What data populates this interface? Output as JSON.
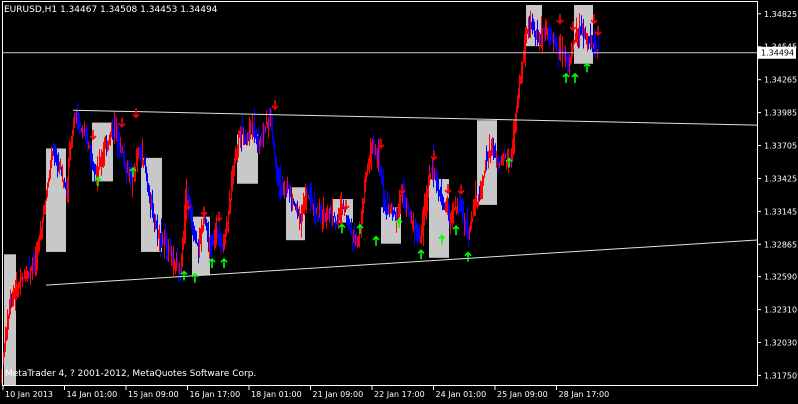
{
  "window": {
    "symbol_info": "EURUSD,H1  1.34467 1.34508 1.34453 1.34494",
    "copyright": "MetaTrader 4, ? 2001-2012, MetaQuotes Software Corp.",
    "current_price_label": "1.34494"
  },
  "colors": {
    "background": "#000000",
    "frame": "#ffffff",
    "bull": "#ff0000",
    "bear": "#0000ff",
    "box": "#c8c8c8",
    "trendline": "#d8e8d8",
    "up_arrow": "#00ff00",
    "down_arrow": "#ff0000"
  },
  "chart_data": {
    "type": "candlestick",
    "symbol": "EURUSD",
    "timeframe": "H1",
    "ylim": [
      1.3166,
      1.349
    ],
    "y_ticks": [
      "1.34825",
      "1.34545",
      "1.34265",
      "1.33985",
      "1.33705",
      "1.33425",
      "1.33145",
      "1.32865",
      "1.32590",
      "1.32310",
      "1.32030",
      "1.31750"
    ],
    "x_ticks": [
      "10 Jan 2013",
      "14 Jan 01:00",
      "15 Jan 09:00",
      "16 Jan 17:00",
      "18 Jan 01:00",
      "21 Jan 09:00",
      "22 Jan 17:00",
      "24 Jan 01:00",
      "25 Jan 09:00",
      "28 Jan 17:00"
    ],
    "current_price": 1.34494,
    "price_path": [
      [
        0,
        1.3173
      ],
      [
        10,
        1.324
      ],
      [
        22,
        1.3256
      ],
      [
        36,
        1.3275
      ],
      [
        46,
        1.333
      ],
      [
        52,
        1.3365
      ],
      [
        60,
        1.335
      ],
      [
        66,
        1.333
      ],
      [
        70,
        1.337
      ],
      [
        74,
        1.3398
      ],
      [
        80,
        1.3385
      ],
      [
        88,
        1.3372
      ],
      [
        96,
        1.3345
      ],
      [
        102,
        1.3362
      ],
      [
        108,
        1.3375
      ],
      [
        114,
        1.3388
      ],
      [
        120,
        1.337
      ],
      [
        126,
        1.335
      ],
      [
        132,
        1.334
      ],
      [
        138,
        1.3365
      ],
      [
        144,
        1.3355
      ],
      [
        150,
        1.332
      ],
      [
        156,
        1.33
      ],
      [
        162,
        1.329
      ],
      [
        168,
        1.3285
      ],
      [
        174,
        1.327
      ],
      [
        180,
        1.3262
      ],
      [
        186,
        1.333
      ],
      [
        192,
        1.33
      ],
      [
        198,
        1.3285
      ],
      [
        204,
        1.331
      ],
      [
        210,
        1.328
      ],
      [
        216,
        1.33
      ],
      [
        222,
        1.3285
      ],
      [
        228,
        1.331
      ],
      [
        234,
        1.336
      ],
      [
        240,
        1.3385
      ],
      [
        246,
        1.3375
      ],
      [
        252,
        1.339
      ],
      [
        258,
        1.337
      ],
      [
        264,
        1.3385
      ],
      [
        270,
        1.3395
      ],
      [
        276,
        1.335
      ],
      [
        282,
        1.333
      ],
      [
        288,
        1.3335
      ],
      [
        294,
        1.332
      ],
      [
        300,
        1.331
      ],
      [
        306,
        1.333
      ],
      [
        312,
        1.332
      ],
      [
        318,
        1.331
      ],
      [
        324,
        1.331
      ],
      [
        330,
        1.3315
      ],
      [
        336,
        1.3305
      ],
      [
        342,
        1.332
      ],
      [
        348,
        1.3305
      ],
      [
        354,
        1.329
      ],
      [
        360,
        1.33
      ],
      [
        366,
        1.335
      ],
      [
        372,
        1.337
      ],
      [
        378,
        1.336
      ],
      [
        384,
        1.332
      ],
      [
        390,
        1.3315
      ],
      [
        396,
        1.331
      ],
      [
        402,
        1.333
      ],
      [
        408,
        1.3315
      ],
      [
        414,
        1.33
      ],
      [
        420,
        1.329
      ],
      [
        426,
        1.333
      ],
      [
        432,
        1.3355
      ],
      [
        438,
        1.333
      ],
      [
        444,
        1.332
      ],
      [
        450,
        1.331
      ],
      [
        456,
        1.332
      ],
      [
        462,
        1.3315
      ],
      [
        468,
        1.3295
      ],
      [
        474,
        1.332
      ],
      [
        480,
        1.333
      ],
      [
        486,
        1.336
      ],
      [
        492,
        1.337
      ],
      [
        498,
        1.3355
      ],
      [
        504,
        1.336
      ],
      [
        510,
        1.3355
      ],
      [
        516,
        1.34
      ],
      [
        520,
        1.343
      ],
      [
        526,
        1.3465
      ],
      [
        532,
        1.3475
      ],
      [
        538,
        1.346
      ],
      [
        544,
        1.347
      ],
      [
        550,
        1.3465
      ],
      [
        556,
        1.3455
      ],
      [
        562,
        1.345
      ],
      [
        568,
        1.344
      ],
      [
        574,
        1.346
      ],
      [
        580,
        1.347
      ],
      [
        586,
        1.3462
      ],
      [
        592,
        1.3458
      ],
      [
        598,
        1.34494
      ]
    ],
    "boxes": [
      {
        "x0": 4,
        "x1": 16,
        "lo": 1.3166,
        "hi": 1.3278
      },
      {
        "x0": 46,
        "x1": 66,
        "lo": 1.328,
        "hi": 1.3368
      },
      {
        "x0": 92,
        "x1": 113,
        "lo": 1.334,
        "hi": 1.339
      },
      {
        "x0": 141,
        "x1": 162,
        "lo": 1.328,
        "hi": 1.336
      },
      {
        "x0": 192,
        "x1": 210,
        "lo": 1.326,
        "hi": 1.331
      },
      {
        "x0": 237,
        "x1": 258,
        "lo": 1.3338,
        "hi": 1.338
      },
      {
        "x0": 286,
        "x1": 305,
        "lo": 1.329,
        "hi": 1.3335
      },
      {
        "x0": 333,
        "x1": 353,
        "lo": 1.3305,
        "hi": 1.3325
      },
      {
        "x0": 381,
        "x1": 401,
        "lo": 1.3287,
        "hi": 1.3318
      },
      {
        "x0": 429,
        "x1": 449,
        "lo": 1.3275,
        "hi": 1.3342
      },
      {
        "x0": 477,
        "x1": 497,
        "lo": 1.332,
        "hi": 1.3392
      },
      {
        "x0": 526,
        "x1": 542,
        "lo": 1.3455,
        "hi": 1.349
      },
      {
        "x0": 574,
        "x1": 593,
        "lo": 1.344,
        "hi": 1.349
      }
    ],
    "trendlines": [
      {
        "x0": 73,
        "y0": 1.34005,
        "x1": 757,
        "y1": 1.33878
      },
      {
        "x0": 46,
        "y0": 1.32518,
        "x1": 757,
        "y1": 1.32902
      }
    ],
    "down_arrows": [
      {
        "x": 93,
        "p": 1.33795
      },
      {
        "x": 122,
        "p": 1.339
      },
      {
        "x": 136,
        "p": 1.3398
      },
      {
        "x": 188,
        "p": 1.332
      },
      {
        "x": 204,
        "p": 1.33145
      },
      {
        "x": 219,
        "p": 1.331
      },
      {
        "x": 275,
        "p": 1.3405
      },
      {
        "x": 346,
        "p": 1.332
      },
      {
        "x": 381,
        "p": 1.3372
      },
      {
        "x": 402,
        "p": 1.33335
      },
      {
        "x": 434,
        "p": 1.3362
      },
      {
        "x": 448,
        "p": 1.33335
      },
      {
        "x": 461,
        "p": 1.3333
      },
      {
        "x": 560,
        "p": 1.3478
      },
      {
        "x": 573,
        "p": 1.3472
      },
      {
        "x": 594,
        "p": 1.3478
      },
      {
        "x": 598,
        "p": 1.3468
      }
    ],
    "up_arrows": [
      {
        "x": 98,
        "p": 1.334
      },
      {
        "x": 133,
        "p": 1.3348
      },
      {
        "x": 184,
        "p": 1.326
      },
      {
        "x": 195,
        "p": 1.3258
      },
      {
        "x": 212,
        "p": 1.32705
      },
      {
        "x": 224,
        "p": 1.32705
      },
      {
        "x": 342,
        "p": 1.33
      },
      {
        "x": 360,
        "p": 1.32995
      },
      {
        "x": 376,
        "p": 1.32895
      },
      {
        "x": 399,
        "p": 1.33045
      },
      {
        "x": 421,
        "p": 1.3278
      },
      {
        "x": 442,
        "p": 1.32905
      },
      {
        "x": 456,
        "p": 1.32985
      },
      {
        "x": 468,
        "p": 1.3276
      },
      {
        "x": 509,
        "p": 1.3356
      },
      {
        "x": 566,
        "p": 1.3428
      },
      {
        "x": 575,
        "p": 1.3428
      },
      {
        "x": 587,
        "p": 1.3437
      }
    ]
  }
}
